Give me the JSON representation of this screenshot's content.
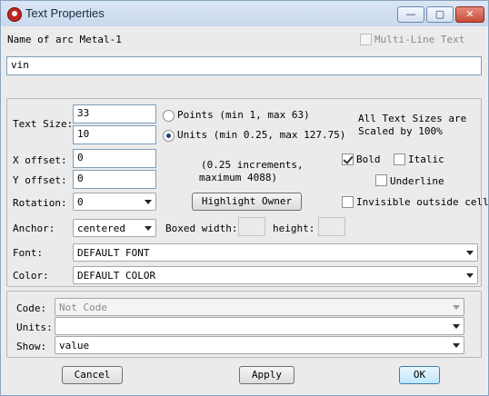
{
  "window": {
    "title": "Text Properties",
    "controls": {
      "minimize": "—",
      "maximize": "▢",
      "close": "✕"
    }
  },
  "header": {
    "name_label": "Name of arc Metal-1",
    "multiline_label": "Multi-Line Text",
    "multiline_checked": false,
    "text_value": "vin"
  },
  "size": {
    "label": "Text Size:",
    "points_value": "33",
    "units_value": "10",
    "points_label": "Points (min 1, max 63)",
    "units_label": "Units (min 0.25, max 127.75)",
    "selected": "units",
    "note_line1": "All Text Sizes are",
    "note_line2": "Scaled by 100%"
  },
  "offsets": {
    "x_label": "X offset:",
    "x_value": "0",
    "y_label": "Y offset:",
    "y_value": "0",
    "increments_line1": "(0.25 increments,",
    "increments_line2": "maximum 4088)"
  },
  "style": {
    "bold_label": "Bold",
    "bold_checked": true,
    "italic_label": "Italic",
    "italic_checked": false,
    "underline_label": "Underline",
    "underline_checked": false,
    "invisible_label": "Invisible outside cell",
    "invisible_checked": false
  },
  "rotation": {
    "label": "Rotation:",
    "value": "0"
  },
  "highlight_owner_label": "Highlight Owner",
  "anchor": {
    "label": "Anchor:",
    "value": "centered",
    "boxed_width_label": "Boxed width:",
    "height_label": "height:"
  },
  "font": {
    "label": "Font:",
    "value": "DEFAULT FONT"
  },
  "color": {
    "label": "Color:",
    "value": "DEFAULT COLOR"
  },
  "code_section": {
    "code_label": "Code:",
    "code_value": "Not Code",
    "units_label": "Units:",
    "units_value": "",
    "show_label": "Show:",
    "show_value": "value"
  },
  "buttons": {
    "cancel": "Cancel",
    "apply": "Apply",
    "ok": "OK"
  }
}
